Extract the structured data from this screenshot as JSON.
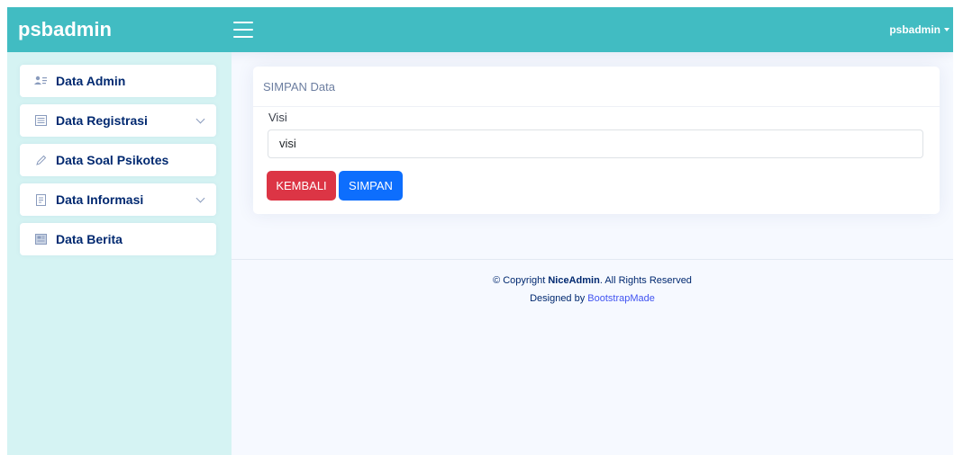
{
  "header": {
    "brand": "psbadmin",
    "user": "psbadmin"
  },
  "sidebar": {
    "items": [
      {
        "label": "Data Admin",
        "icon": "people-icon",
        "has_chevron": false
      },
      {
        "label": "Data Registrasi",
        "icon": "list-icon",
        "has_chevron": true
      },
      {
        "label": "Data Soal Psikotes",
        "icon": "pencil-icon",
        "has_chevron": false
      },
      {
        "label": "Data Informasi",
        "icon": "document-icon",
        "has_chevron": true
      },
      {
        "label": "Data Berita",
        "icon": "newspaper-icon",
        "has_chevron": false
      }
    ]
  },
  "form": {
    "title": "SIMPAN Data",
    "field_label": "Visi",
    "field_value": "visi",
    "back_label": "KEMBALI",
    "save_label": "SIMPAN"
  },
  "footer": {
    "copyright_prefix": "© Copyright ",
    "brand": "NiceAdmin",
    "copyright_suffix": ". All Rights Reserved",
    "designed_prefix": "Designed by ",
    "designer": "BootstrapMade"
  },
  "colors": {
    "header_bg": "#41bcc2",
    "sidebar_bg": "#d5f3f3",
    "danger": "#dc3545",
    "primary": "#0d6efd"
  }
}
